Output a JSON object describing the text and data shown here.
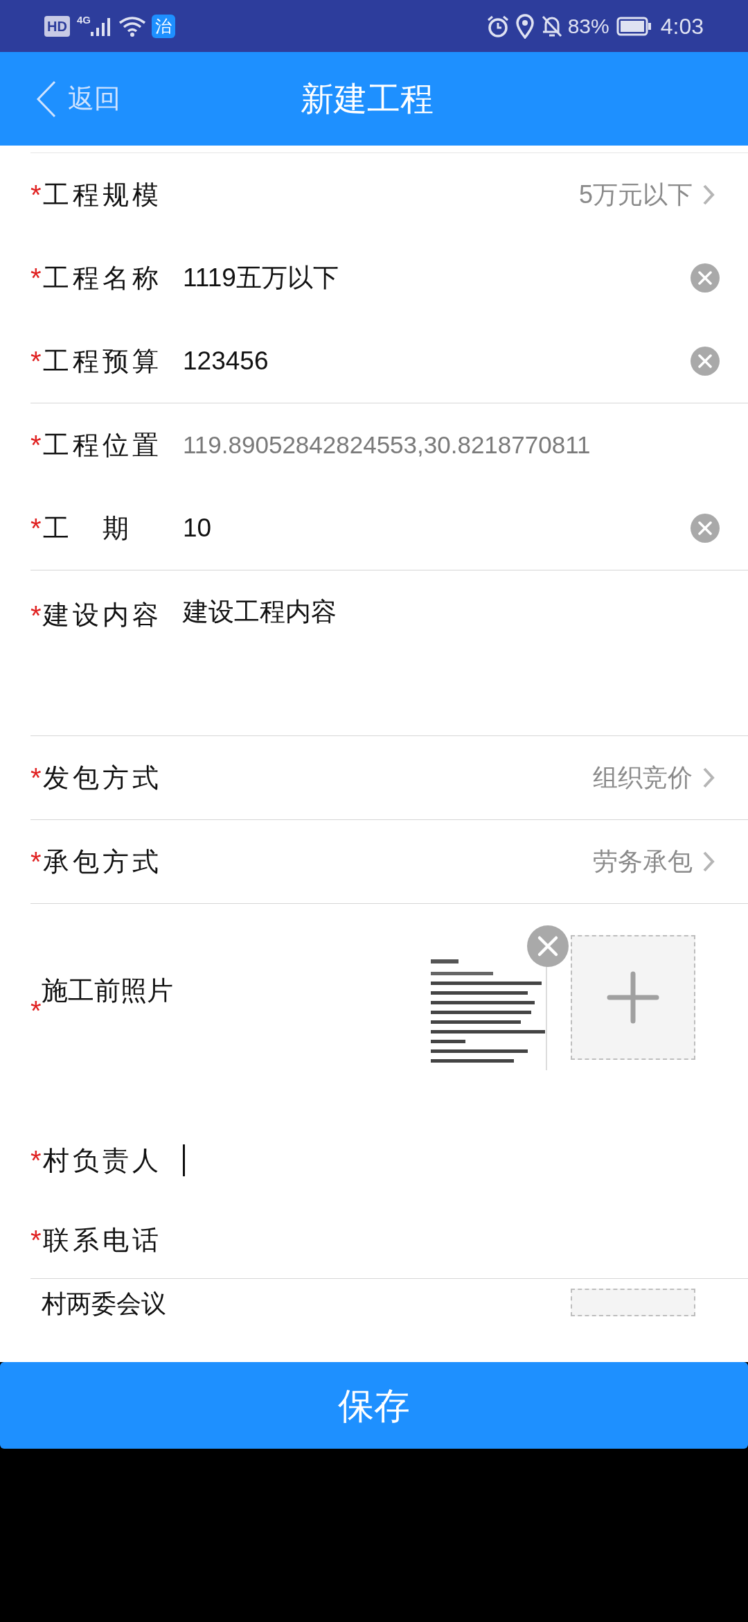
{
  "status_bar": {
    "hd": "HD",
    "network": "4G",
    "app_badge": "治",
    "battery": "83%",
    "time": "4:03"
  },
  "header": {
    "back": "返回",
    "title": "新建工程"
  },
  "sections": [
    {
      "fields": [
        {
          "kind": "select",
          "required_mark": "*",
          "label": "工程规模",
          "value": "5万元以下"
        },
        {
          "kind": "input",
          "required_mark": "*",
          "label": "工程名称",
          "value": "1119五万以下"
        },
        {
          "kind": "input",
          "required_mark": "*",
          "label": "工程预算",
          "value": "123456"
        }
      ]
    },
    {
      "fields": [
        {
          "kind": "readonly",
          "required_mark": "*",
          "label": "工程位置",
          "value": "119.89052842824553,30.8218770811"
        },
        {
          "kind": "input",
          "required_mark": "*",
          "label": "工　期",
          "value": "10"
        }
      ]
    },
    {
      "fields": [
        {
          "kind": "textarea",
          "required_mark": "*",
          "label": "建设内容",
          "value": "建设工程内容"
        }
      ]
    },
    {
      "fields": [
        {
          "kind": "select",
          "required_mark": "*",
          "label": "发包方式",
          "value": "组织竞价"
        }
      ]
    },
    {
      "fields": [
        {
          "kind": "select",
          "required_mark": "*",
          "label": "承包方式",
          "value": "劳务承包"
        }
      ]
    },
    {
      "fields": [
        {
          "kind": "photos",
          "required_mark": "*",
          "label": "施工前照片"
        },
        {
          "kind": "focused",
          "required_mark": "*",
          "label": "村负责人"
        },
        {
          "kind": "empty",
          "required_mark": "*",
          "label": "联系电话"
        }
      ]
    },
    {
      "fields": [
        {
          "kind": "photos_partial",
          "label": "村两委会议"
        }
      ]
    }
  ],
  "save_button": "保存"
}
